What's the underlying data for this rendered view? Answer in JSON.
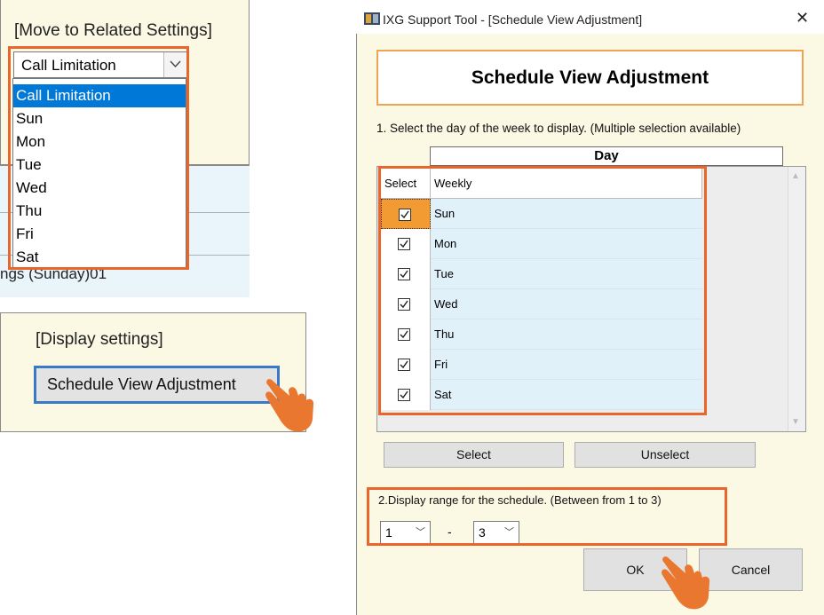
{
  "related_settings": {
    "title": "[Move to Related Settings]",
    "selected": "Call Limitation",
    "options": [
      "Call Limitation",
      "Sun",
      "Mon",
      "Tue",
      "Wed",
      "Thu",
      "Fri",
      "Sat"
    ],
    "behind_text": "ngs (Sunday)01"
  },
  "display_settings": {
    "title": "[Display settings]",
    "button_label": "Schedule View Adjustment"
  },
  "dialog": {
    "window_title": "IXG Support Tool - [Schedule View Adjustment]",
    "close_glyph": "✕",
    "header": "Schedule View Adjustment",
    "step1_label": "1. Select the day of the week to display. (Multiple selection available)",
    "day_header": "Day",
    "col_select": "Select",
    "col_weekly": "Weekly",
    "days": [
      {
        "label": "Sun",
        "checked": true
      },
      {
        "label": "Mon",
        "checked": true
      },
      {
        "label": "Tue",
        "checked": true
      },
      {
        "label": "Wed",
        "checked": true
      },
      {
        "label": "Thu",
        "checked": true
      },
      {
        "label": "Fri",
        "checked": true
      },
      {
        "label": "Sat",
        "checked": true
      }
    ],
    "select_button": "Select",
    "unselect_button": "Unselect",
    "step2_label": "2.Display range for the schedule. (Between from 1 to 3)",
    "range_from": "1",
    "range_separator": "-",
    "range_to": "3",
    "ok_button": "OK",
    "cancel_button": "Cancel"
  },
  "colors": {
    "highlight": "#e8652c",
    "panel_bg": "#fbf8e3",
    "selection_blue": "#0078d7",
    "hand": "#e9772f"
  },
  "icons": {
    "checkbox": "check-icon",
    "pointer": "hand-pointer-icon",
    "dropdown": "chevron-down-icon"
  }
}
